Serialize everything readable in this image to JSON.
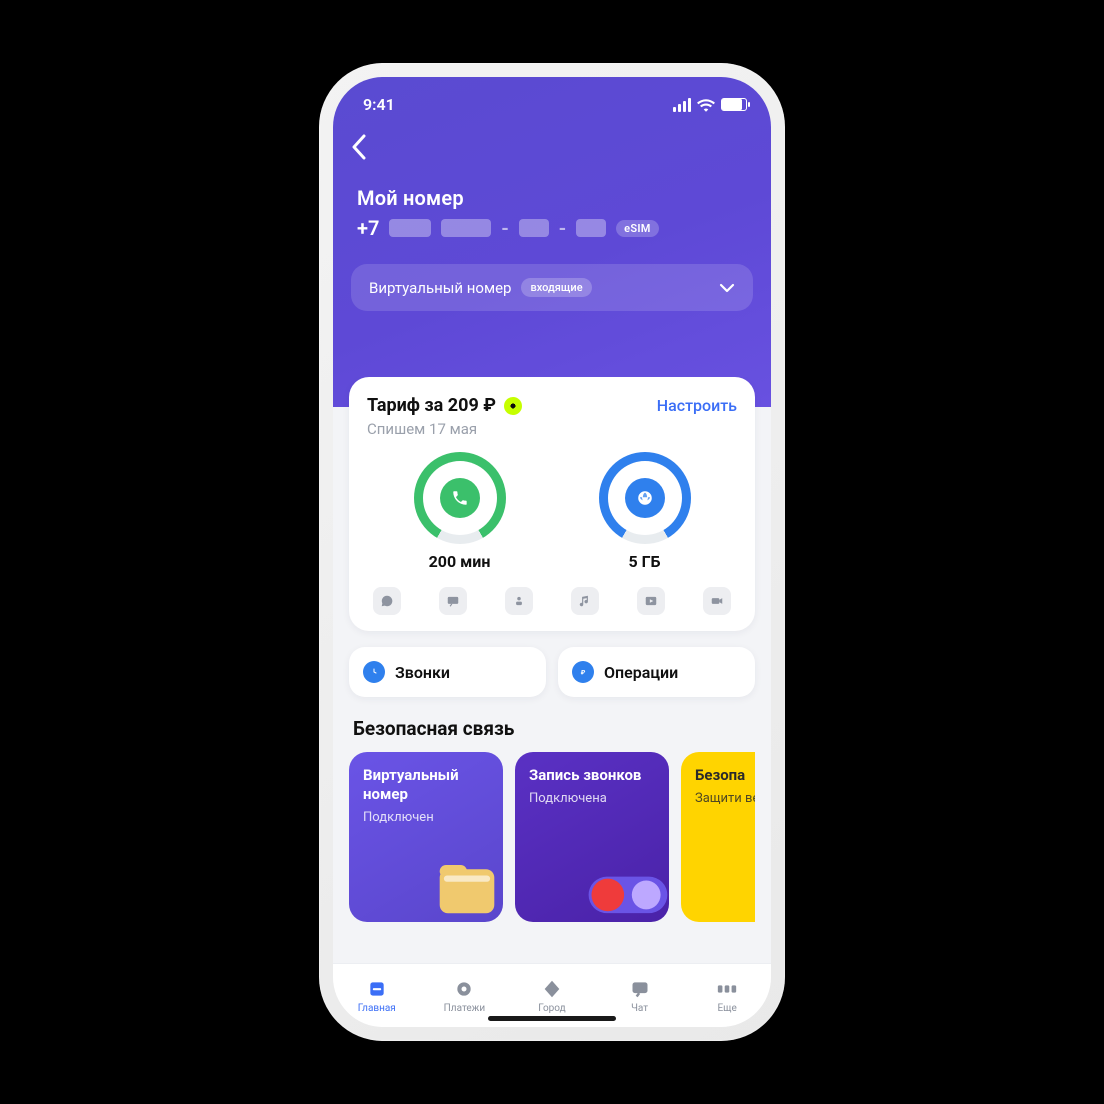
{
  "status": {
    "time": "9:41"
  },
  "header": {
    "title": "Мой номер",
    "phone_prefix": "+7",
    "esim_badge": "eSIM",
    "dropdown_label": "Виртуальный номер",
    "dropdown_pill": "входящие"
  },
  "tariff": {
    "title": "Тариф за 209 ₽",
    "configure_label": "Настроить",
    "subtitle": "Спишем 17 мая",
    "minutes_label": "200 мин",
    "data_label": "5 ГБ"
  },
  "quick": {
    "calls_label": "Звонки",
    "ops_label": "Операции"
  },
  "secure": {
    "heading": "Безопасная связь",
    "tiles": [
      {
        "title": "Виртуальный номер",
        "status": "Подключен"
      },
      {
        "title": "Запись звонков",
        "status": "Подключена"
      },
      {
        "title": "Безопа",
        "status": "Защити вернем"
      }
    ]
  },
  "nav": {
    "items": [
      "Главная",
      "Платежи",
      "Город",
      "Чат",
      "Еще"
    ]
  }
}
